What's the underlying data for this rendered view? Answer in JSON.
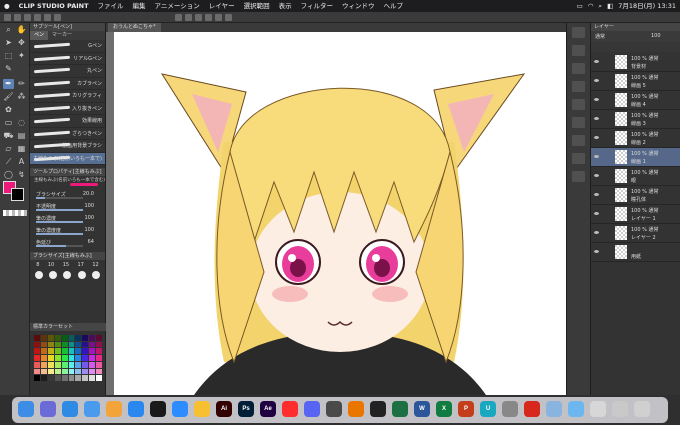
{
  "menubar": {
    "apple": "",
    "app_name": "CLIP STUDIO PAINT",
    "items": [
      "ファイル",
      "編集",
      "アニメーション",
      "レイヤー",
      "選択範囲",
      "表示",
      "フィルター",
      "ウィンドウ",
      "ヘルプ"
    ],
    "clock": "7月18日(月) 13:31"
  },
  "subtool": {
    "header": "サブツール[ペン]",
    "tabs": [
      "ペン",
      "マーカー"
    ],
    "brushes": [
      "Gペン",
      "リアルGペン",
      "丸ペン",
      "カブラペン",
      "カリグラフィ",
      "入り抜きペン",
      "効果線用",
      "ざらつきペン",
      "筋画用背景ブラシ",
      "主線もみぶ(名前いろも一本で)"
    ],
    "selected_brush": "主線もみぶ(名前いろも一本で)"
  },
  "toolprop": {
    "header": "ツールプロパティ[主線もみぶ]",
    "preview_label": "主線もみぶ(名前いろも一本で含む)",
    "props": [
      {
        "label": "ブラシサイズ",
        "value": "20.0",
        "fill": 0.2
      },
      {
        "label": "不透明度",
        "value": "100",
        "fill": 1.0
      },
      {
        "label": "筆の濃度",
        "value": "100",
        "fill": 1.0
      },
      {
        "label": "筆の濃度度",
        "value": "100",
        "fill": 1.0
      },
      {
        "label": "色延び",
        "value": "64",
        "fill": 0.64
      }
    ]
  },
  "brushsize": {
    "header": "ブラシサイズ[主線もみぶ]",
    "sizes": [
      "8",
      "10",
      "15",
      "17",
      "12"
    ]
  },
  "colorset": {
    "header": "標準カラーセット"
  },
  "canvas": {
    "tab_title": "おうんとぬこちゃ*"
  },
  "layers": {
    "header": "レイヤー",
    "blend": "通常",
    "opacity": "100",
    "rows": [
      {
        "l1": "100 % 通常",
        "l2": "背景材",
        "selected": false
      },
      {
        "l1": "100 % 通常",
        "l2": "線画 5",
        "selected": false
      },
      {
        "l1": "100 % 通常",
        "l2": "線画 4",
        "selected": false
      },
      {
        "l1": "100 % 通常",
        "l2": "線画 3",
        "selected": false
      },
      {
        "l1": "100 % 通常",
        "l2": "線画 2",
        "selected": false
      },
      {
        "l1": "100 % 通常",
        "l2": "線画 1",
        "selected": true
      },
      {
        "l1": "100 % 通常",
        "l2": "眼",
        "selected": false
      },
      {
        "l1": "100 % 通常",
        "l2": "瞳孔体",
        "selected": false
      },
      {
        "l1": "100 % 通常",
        "l2": "レイヤー 1",
        "selected": false
      },
      {
        "l1": "100 % 通常",
        "l2": "レイヤー 2",
        "selected": false
      },
      {
        "l1": "",
        "l2": "用紙",
        "selected": false
      }
    ]
  },
  "dock": {
    "apps": [
      {
        "icon": "finder-icon",
        "color": "#3d8ce6",
        "text": ""
      },
      {
        "icon": "launchpad-icon",
        "color": "#6b6bd8",
        "text": ""
      },
      {
        "icon": "safari-icon",
        "color": "#2e8be3",
        "text": ""
      },
      {
        "icon": "mail-icon",
        "color": "#4a9bee",
        "text": ""
      },
      {
        "icon": "photos-icon",
        "color": "#f2a33a",
        "text": ""
      },
      {
        "icon": "appstore-icon",
        "color": "#2b87f0",
        "text": ""
      },
      {
        "icon": "onenote-icon",
        "color": "#1a1a1a",
        "text": ""
      },
      {
        "icon": "zoom-icon",
        "color": "#2d8cff",
        "text": ""
      },
      {
        "icon": "clipstudio-icon",
        "color": "#f6c030",
        "text": ""
      },
      {
        "icon": "illustrator-icon",
        "color": "#330000",
        "text": "Ai"
      },
      {
        "icon": "photoshop-icon",
        "color": "#001e36",
        "text": "Ps"
      },
      {
        "icon": "aftereffects-icon",
        "color": "#1f0040",
        "text": "Ae"
      },
      {
        "icon": "youtube-icon",
        "color": "#ff2d2d",
        "text": ""
      },
      {
        "icon": "discord-icon",
        "color": "#5865f2",
        "text": ""
      },
      {
        "icon": "chatgpt-icon",
        "color": "#4a4a4a",
        "text": ""
      },
      {
        "icon": "blender-icon",
        "color": "#ea7600",
        "text": ""
      },
      {
        "icon": "unity-icon",
        "color": "#222",
        "text": ""
      },
      {
        "icon": "excel-icon",
        "color": "#1d7044",
        "text": ""
      },
      {
        "icon": "word-icon",
        "color": "#2b579a",
        "text": "W"
      },
      {
        "icon": "excel2-icon",
        "color": "#107c41",
        "text": "X"
      },
      {
        "icon": "powerpoint-icon",
        "color": "#c43e1c",
        "text": "P"
      },
      {
        "icon": "utility-icon",
        "color": "#18a9c0",
        "text": "U"
      },
      {
        "icon": "search-icon",
        "color": "#888",
        "text": ""
      },
      {
        "icon": "acrobat-icon",
        "color": "#d8271c",
        "text": ""
      },
      {
        "icon": "preview-icon",
        "color": "#8ab4e0",
        "text": ""
      },
      {
        "icon": "folder-icon",
        "color": "#6db7f0",
        "text": ""
      },
      {
        "icon": "window-icon",
        "color": "#d7d7d7",
        "text": ""
      },
      {
        "icon": "window2-icon",
        "color": "#c9c9c9",
        "text": ""
      },
      {
        "icon": "trash-icon",
        "color": "#d0d0d0",
        "text": ""
      }
    ]
  }
}
